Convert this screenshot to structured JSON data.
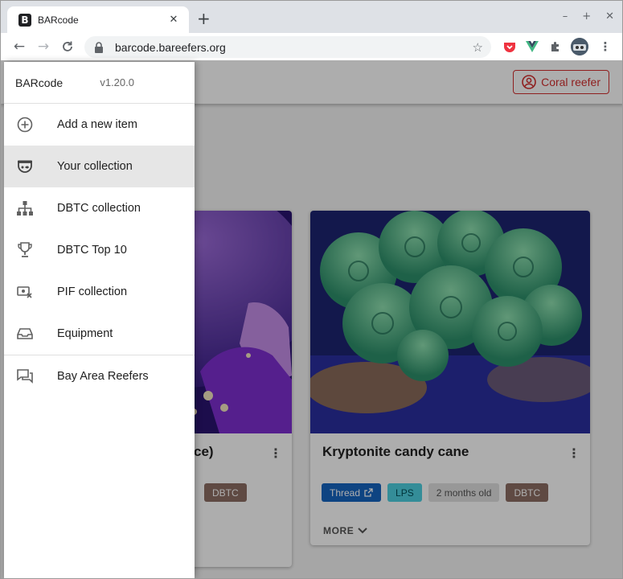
{
  "browser": {
    "tab_title": "BARcode",
    "favicon_letter": "B",
    "url": "barcode.bareefers.org",
    "icons": [
      "back-icon",
      "forward-icon",
      "reload-icon",
      "lock-icon",
      "star-icon",
      "pocket-icon",
      "vue-devtools-icon",
      "extensions-icon",
      "profile-avatar",
      "menu-icon"
    ]
  },
  "appbar": {
    "user_button": "Coral reefer"
  },
  "drawer": {
    "app_name": "BARcode",
    "version": "v1.20.0",
    "items": [
      {
        "label": "Add a new item",
        "icon": "add-circle-icon"
      },
      {
        "label": "Your collection",
        "icon": "fish-tank-icon",
        "active": true
      },
      {
        "label": "DBTC collection",
        "icon": "hierarchy-icon"
      },
      {
        "label": "DBTC Top 10",
        "icon": "trophy-icon"
      },
      {
        "label": "PIF collection",
        "icon": "money-off-icon"
      },
      {
        "label": "Equipment",
        "icon": "inbox-tray-icon"
      }
    ],
    "secondary_items": [
      {
        "label": "Bay Area Reefers",
        "icon": "forum-icon"
      }
    ]
  },
  "cards": [
    {
      "title_visible": "ce)",
      "tags": [
        "DBTC"
      ]
    },
    {
      "title": "Kryptonite candy cane",
      "tags": [
        "Thread",
        "LPS",
        "2 months old",
        "DBTC"
      ],
      "more_label": "MORE"
    }
  ],
  "colors": {
    "accent_red": "#d32f2f",
    "thread_chip": "#1565c0",
    "lps_chip": "#4dd0e1",
    "dbtc_chip": "#8d6e63",
    "scrim": "rgba(0,0,0,0.32)"
  }
}
